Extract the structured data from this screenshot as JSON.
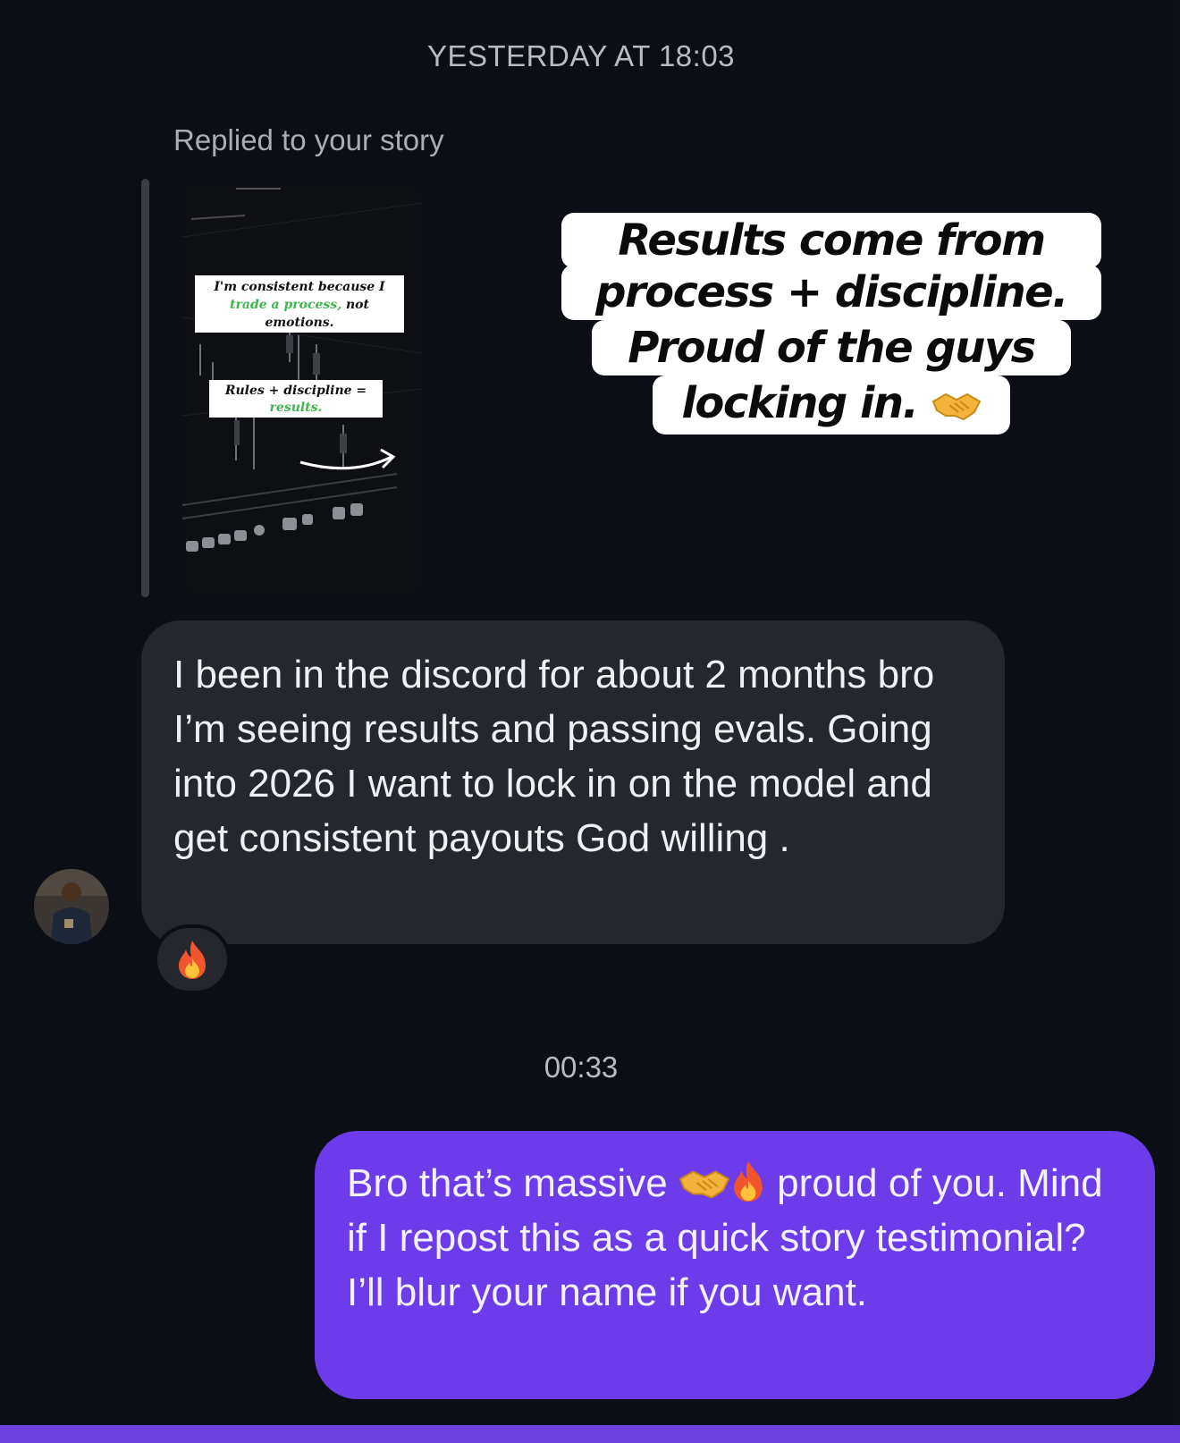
{
  "timestamps": {
    "first": "YESTERDAY AT 18:03",
    "second": "00:33"
  },
  "story_reply": {
    "label": "Replied to your story",
    "thumbnail_text": {
      "line1": "I'm consistent because I",
      "line2_highlight": "trade a process,",
      "line2_rest": " not",
      "line3": "emotions.",
      "rules": "Rules + discipline =",
      "results": "results."
    }
  },
  "overlay_caption": {
    "line1": "Results come from",
    "line2": "process + discipline.",
    "line3": "Proud of the guys",
    "line4": "locking in."
  },
  "received_message": {
    "text": "I been in the discord for about 2 months bro I’m seeing results and passing evals. Going into 2026 I want to lock in on the model and get consistent payouts God willing .",
    "reaction": "fire-emoji"
  },
  "sent_message": {
    "part1": "Bro that’s massive ",
    "part2": " proud of you. Mind if I repost this as a quick story testimonial? I’ll blur your name if you want."
  },
  "icons": {
    "handshake": "handshake-emoji",
    "fire": "fire-emoji"
  },
  "colors": {
    "background": "#0b0e15",
    "received_bubble": "#24272e",
    "sent_bubble": "#6c3bea",
    "highlight_green": "#3fb54f"
  }
}
